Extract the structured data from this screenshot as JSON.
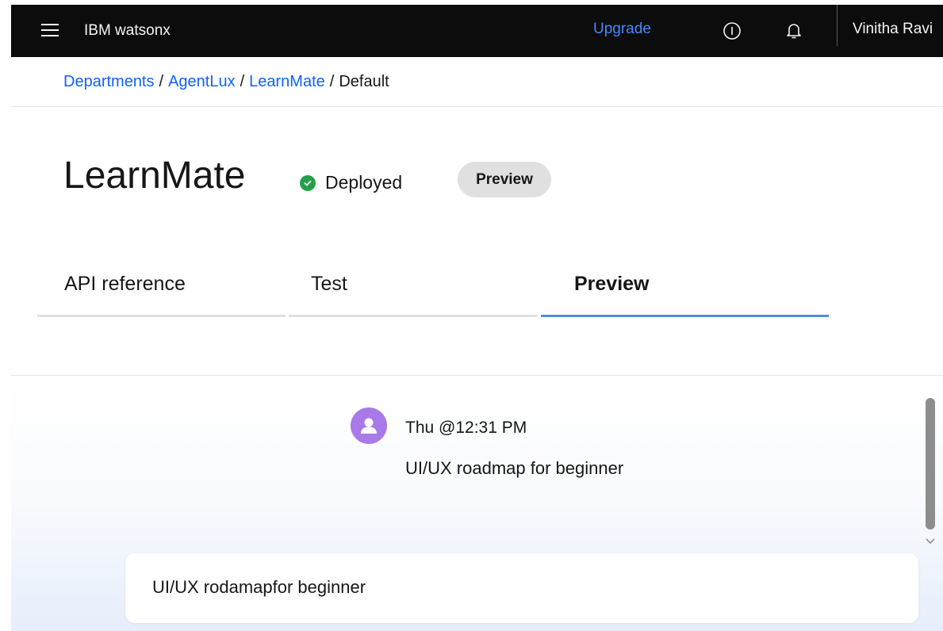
{
  "header": {
    "menu_icon": "hamburger-menu-icon",
    "brand": "IBM watsonx",
    "upgrade_label": "Upgrade",
    "info_icon": "info-icon",
    "notification_icon": "bell-icon",
    "user_name": "Vinitha Ravi"
  },
  "breadcrumb": {
    "items": [
      {
        "label": "Departments",
        "link": true
      },
      {
        "label": "AgentLux",
        "link": true
      },
      {
        "label": "LearnMate",
        "link": true
      },
      {
        "label": "Default",
        "link": false
      }
    ],
    "separator": "/"
  },
  "page": {
    "title": "LearnMate",
    "status_label": "Deployed",
    "status_color": "#24a148",
    "badge_label": "Preview"
  },
  "tabs": [
    {
      "label": "API reference",
      "active": false
    },
    {
      "label": "Test",
      "active": false
    },
    {
      "label": "Preview",
      "active": true
    }
  ],
  "chat": {
    "messages": [
      {
        "avatar_icon": "user-avatar-icon",
        "timestamp": "Thu @12:31 PM",
        "text": "UI/UX roadmap for beginner"
      }
    ],
    "input_value": "UI/UX rodamapfor beginner"
  },
  "colors": {
    "topbar_bg": "#0c0c0c",
    "link": "#0f62fe",
    "upgrade": "#4589ff",
    "active_tab_line": "#4a90e2",
    "avatar_bg": "#a879e8"
  }
}
